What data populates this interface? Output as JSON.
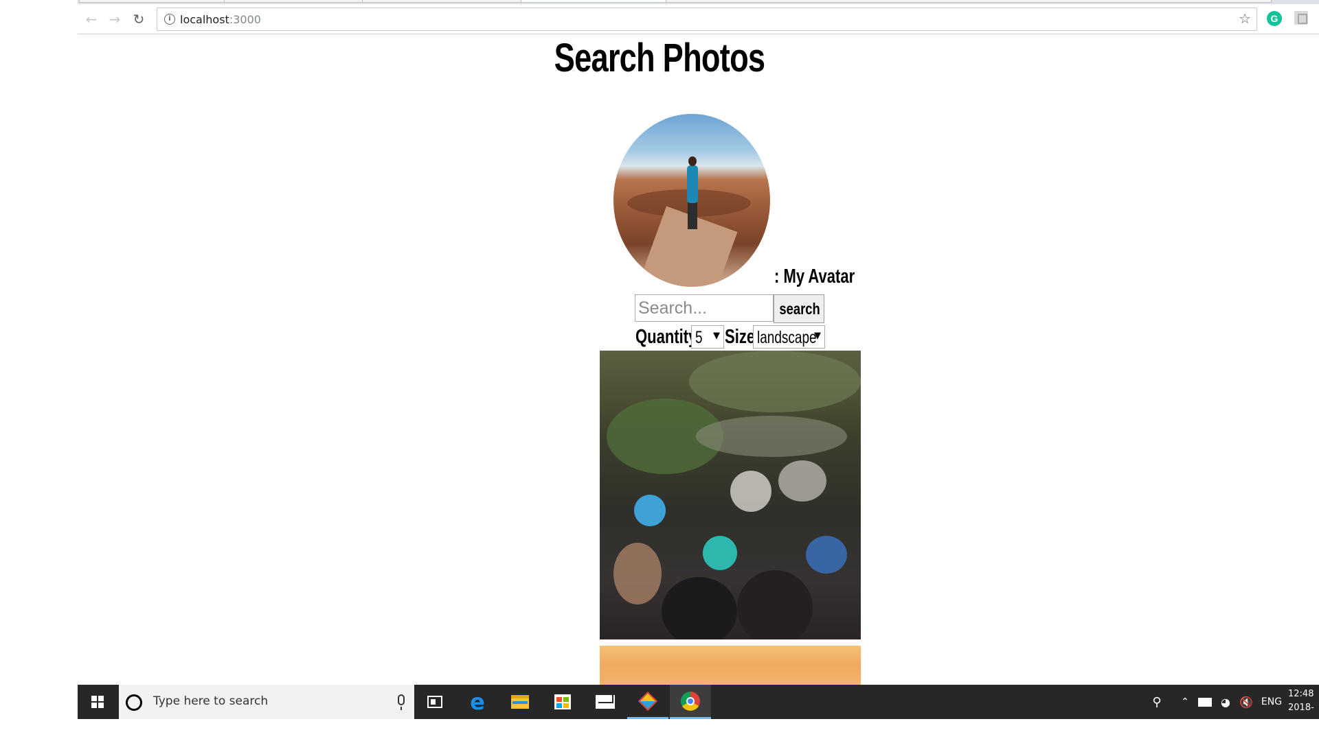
{
  "browser": {
    "url_host": "localhost",
    "url_port": ":3000"
  },
  "page": {
    "title": "Search Photos",
    "avatar_label": ": My Avatar",
    "search": {
      "placeholder": "Search...",
      "button_label": "search"
    },
    "quantity": {
      "label": "Quantity",
      "selected": "5"
    },
    "size": {
      "label": "Size",
      "selected": "landscape"
    }
  },
  "taskbar": {
    "search_placeholder": "Type here to search",
    "tray_language": "ENG",
    "clock_time": "12:48",
    "clock_date": "2018-"
  },
  "icons": {
    "back": "arrow-left",
    "forward": "arrow-right",
    "reload": "reload",
    "info": "info",
    "bookmark": "star",
    "grammarly": "grammarly-g",
    "taskbar": [
      "windows-start",
      "cortana",
      "microphone",
      "task-view",
      "edge",
      "file-explorer",
      "store",
      "mail",
      "git",
      "chrome"
    ],
    "tray": [
      "people",
      "chevron-up",
      "battery",
      "wifi",
      "speaker-muted"
    ]
  },
  "colors": {
    "taskbar": "#272727",
    "taskbar_search": "#f2f2f2",
    "running_indicator": "#76b9ed",
    "grammarly": "#15c39a"
  }
}
